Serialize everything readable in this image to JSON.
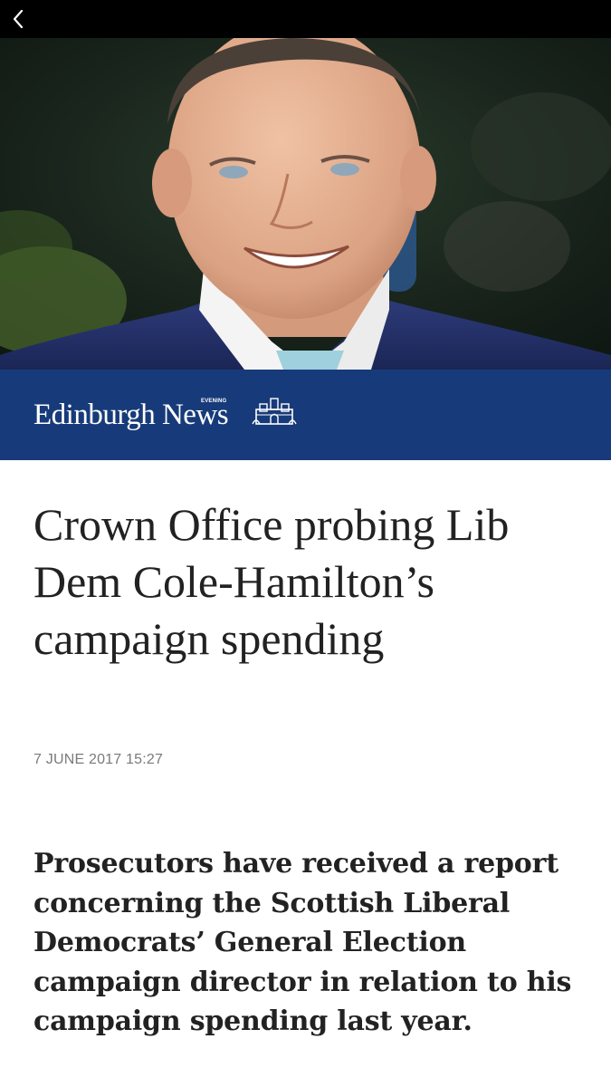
{
  "nav": {
    "back_icon": "chevron-left-icon"
  },
  "hero_image": {
    "alt": "Portrait of a smiling man in a blue suit and light blue tie"
  },
  "masthead": {
    "brand_name": "Edinburgh News",
    "brand_tag": "EVENING",
    "crest_icon": "crest-icon",
    "background_color": "#173b7a"
  },
  "article": {
    "headline": "Crown Office probing Lib Dem Cole-Hamilton’s campaign spending",
    "timestamp": "7 JUNE 2017 15:27",
    "standfirst": "Prosecutors have received a report concerning the Scottish Liberal Democrats’ General Election campaign director in relation to his campaign spending last year."
  }
}
